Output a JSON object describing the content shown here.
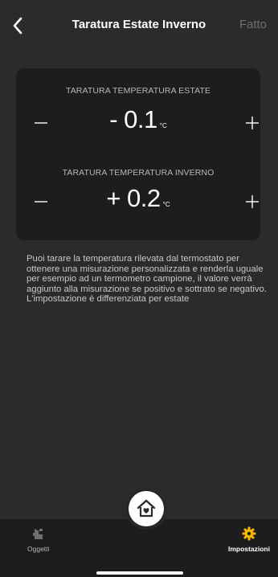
{
  "header": {
    "title": "Taratura Estate Inverno",
    "done_label": "Fatto",
    "back_icon": "chevron-left-icon"
  },
  "summer": {
    "label": "TARATURA TEMPERATURA ESTATE",
    "value": "- 0.1",
    "unit": "°C"
  },
  "winter": {
    "label": "TARATURA TEMPERATURA INVERNO",
    "value": "+ 0.2",
    "unit": "°C"
  },
  "description": {
    "paragraph": "Puoi tarare la temperatura rilevata dal termostato per ottenere una misurazione personalizzata e renderla uguale per esempio ad un termometro campione, il valore verrà aggiunto alla misurazione se positivo e sottrato se negativo.",
    "note": "L'impostazione è differenziata per estate"
  },
  "bottom_nav": {
    "items": [
      {
        "label": "Oggetti",
        "icon": "puzzle-icon",
        "active": false
      },
      {
        "label": "Impostazioni",
        "icon": "gear-icon",
        "active": true
      }
    ],
    "center_icon": "home-heart-icon"
  },
  "colors": {
    "background": "#2b2b2b",
    "card": "#1d1d1d",
    "accent": "#f2b705",
    "inactive": "#6f6f6f"
  }
}
